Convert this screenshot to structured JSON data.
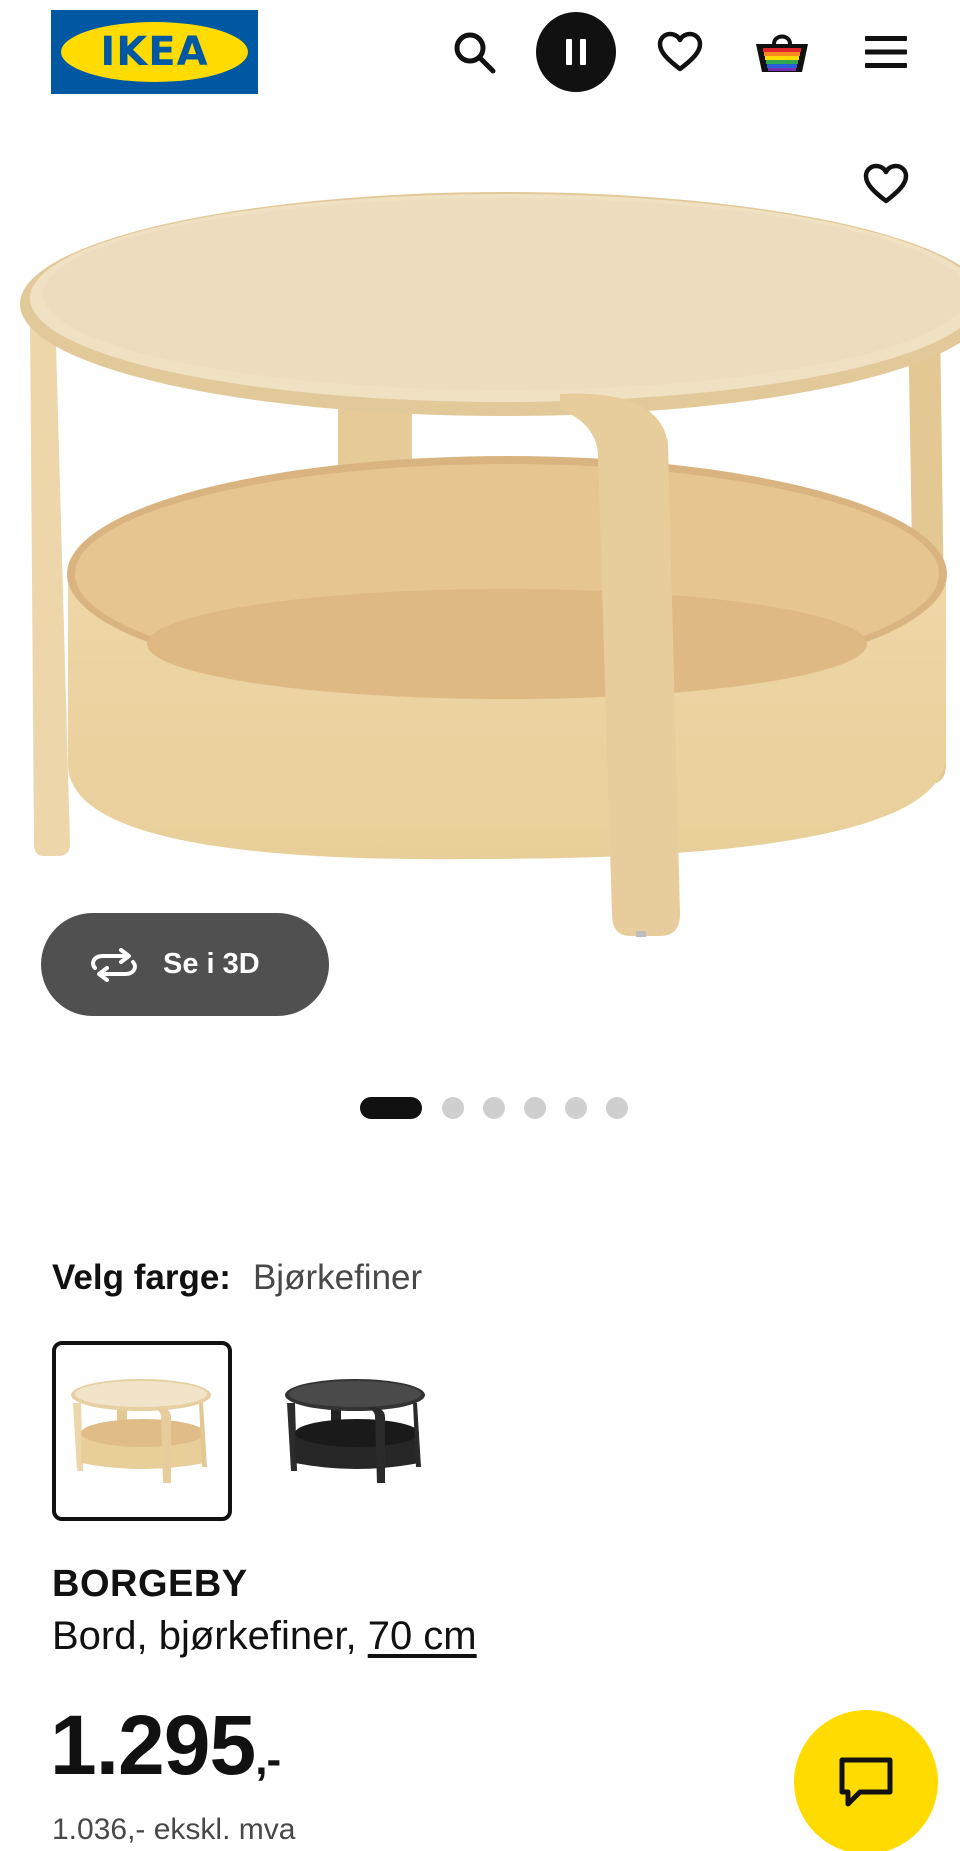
{
  "header": {
    "logo_text": "IKEA",
    "icons": [
      "search-icon",
      "pause-icon",
      "heart-icon",
      "basket-icon",
      "menu-icon"
    ]
  },
  "hero": {
    "favorite_icon": "heart-icon",
    "view_3d_label": "Se i 3D",
    "view_3d_icon": "rotate-icon"
  },
  "carousel": {
    "total": 6,
    "active": 1
  },
  "color_picker": {
    "label": "Velg farge:",
    "selected": "Bjørkefiner",
    "swatches": [
      {
        "color": "#d8bd8a",
        "selected": true
      },
      {
        "color": "#2e2e2e",
        "selected": false
      }
    ]
  },
  "product": {
    "name": "BORGEBY",
    "desc": "Bord, bjørkefiner,",
    "size": "70 cm",
    "price": "1.295",
    "price_suffix": ",-",
    "price_ex_vat": "1.036,- ekskl. mva"
  },
  "chat": {
    "icon": "chat-icon"
  },
  "colors": {
    "ikea_blue": "#0058a3",
    "ikea_yellow": "#ffdb00",
    "button_grey": "#505050"
  }
}
